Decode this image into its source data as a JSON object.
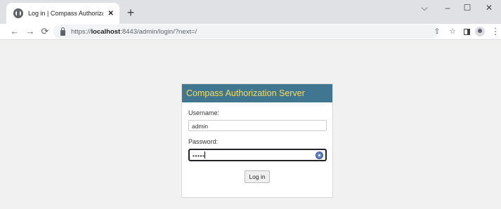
{
  "browser": {
    "tab": {
      "title": "Log in | Compass Authorization Server",
      "close_glyph": "✕"
    },
    "new_tab_glyph": "+",
    "window_controls": {
      "dropdown": "⌵",
      "minimize": "–",
      "maximize": "☐",
      "close": "✕"
    },
    "nav": {
      "back": "←",
      "forward": "→",
      "reload": "⟳"
    },
    "url": {
      "prefix": "https://",
      "host": "localhost",
      "rest": ":8443/admin/login/?next=/"
    },
    "toolbar_icons": {
      "share": "⇪",
      "bookmark": "☆",
      "menu": "⋮"
    }
  },
  "login": {
    "header": "Compass Authorization Server",
    "username_label": "Username:",
    "username_value": "admin",
    "password_label": "Password:",
    "password_value": "•••••",
    "submit_label": "Log in"
  },
  "colors": {
    "header_bg": "#417690",
    "header_text": "#f5dd5d"
  }
}
